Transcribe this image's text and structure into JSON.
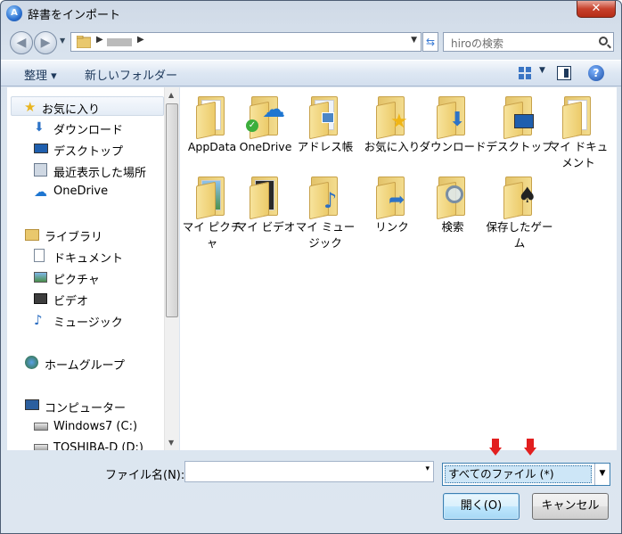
{
  "window": {
    "title": "辞書をインポート",
    "close_glyph": "✕"
  },
  "address": {
    "search_placeholder": "hiroの検索"
  },
  "toolbar": {
    "organize_label": "整理 ▾",
    "new_folder_label": "新しいフォルダー",
    "help_glyph": "?"
  },
  "nav": {
    "items": [
      {
        "label": "お気に入り",
        "icon": "star-icon"
      },
      {
        "label": "ダウンロード",
        "icon": "download-icon"
      },
      {
        "label": "デスクトップ",
        "icon": "desktop-icon"
      },
      {
        "label": "最近表示した場所",
        "icon": "recent-places-icon"
      },
      {
        "label": "OneDrive",
        "icon": "onedrive-icon"
      },
      {
        "label": "ライブラリ",
        "icon": "library-icon"
      },
      {
        "label": "ドキュメント",
        "icon": "documents-icon"
      },
      {
        "label": "ピクチャ",
        "icon": "pictures-icon"
      },
      {
        "label": "ビデオ",
        "icon": "video-icon"
      },
      {
        "label": "ミュージック",
        "icon": "music-icon"
      },
      {
        "label": "ホームグループ",
        "icon": "homegroup-icon"
      },
      {
        "label": "コンピューター",
        "icon": "computer-icon"
      },
      {
        "label": "Windows7 (C:)",
        "icon": "drive-icon"
      },
      {
        "label": "TOSHIBA-D (D:)",
        "icon": "drive-icon"
      }
    ]
  },
  "files": [
    {
      "label": "AppData",
      "icon": "folder-icon"
    },
    {
      "label": "OneDrive",
      "icon": "onedrive-folder-icon"
    },
    {
      "label": "アドレス帳",
      "icon": "contacts-folder-icon"
    },
    {
      "label": "お気に入り",
      "icon": "favorites-folder-icon"
    },
    {
      "label": "ダウンロード",
      "icon": "downloads-folder-icon"
    },
    {
      "label": "デスクトップ",
      "icon": "desktop-folder-icon"
    },
    {
      "label": "マイ ドキュメント",
      "icon": "documents-folder-icon"
    },
    {
      "label": "マイ ピクチャ",
      "icon": "pictures-folder-icon"
    },
    {
      "label": "マイ ビデオ",
      "icon": "videos-folder-icon"
    },
    {
      "label": "マイ ミュージック",
      "icon": "music-folder-icon"
    },
    {
      "label": "リンク",
      "icon": "links-folder-icon"
    },
    {
      "label": "検索",
      "icon": "searches-folder-icon"
    },
    {
      "label": "保存したゲーム",
      "icon": "saved-games-folder-icon"
    }
  ],
  "bottom": {
    "filename_label": "ファイル名(N):",
    "filename_value": "",
    "filter_value": "すべてのファイル (*)",
    "open_label": "開く(O)",
    "cancel_label": "キャンセル"
  },
  "colors": {
    "accent": "#3c7fb1",
    "arrow": "#e21f1f",
    "folder": "#eccb6a"
  }
}
